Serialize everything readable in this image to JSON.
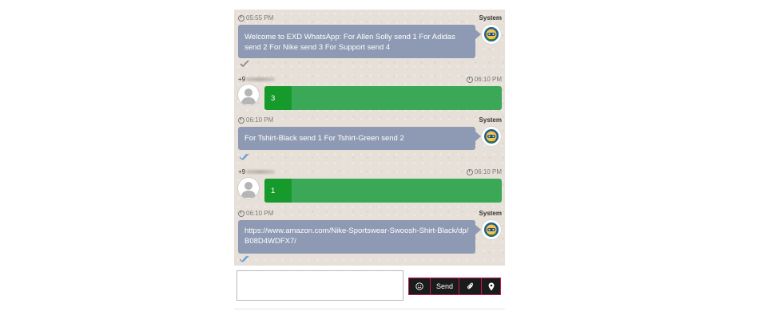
{
  "messages": [
    {
      "type": "system",
      "time": "05:55 PM",
      "sender": "System",
      "text": "Welcome to EXD WhatsApp: For Allen Solly send 1 For Adidas send 2 For Nike send 3  For Support send 4",
      "status": "single-check-icon"
    },
    {
      "type": "user",
      "time": "06:10 PM",
      "sender": "+9",
      "text": "3"
    },
    {
      "type": "system",
      "time": "06:10 PM",
      "sender": "System",
      "text": "For Tshirt-Black send 1 For Tshirt-Green send 2",
      "status": "double-check-icon"
    },
    {
      "type": "user",
      "time": "06:10 PM",
      "sender": "+9",
      "text": "1"
    },
    {
      "type": "system",
      "time": "06:10 PM",
      "sender": "System",
      "text": "https://www.amazon.com/Nike-Sportswear-Swoosh-Shirt-Black/dp/B08D4WDFX7/",
      "status": "double-check-icon"
    }
  ],
  "composer": {
    "placeholder": "",
    "emoji_icon": "smiley-icon",
    "send_label": "Send",
    "attach_icon": "paperclip-icon",
    "location_icon": "location-pin-icon"
  },
  "colors": {
    "system_bubble": "#8e9ab3",
    "user_bubble": "#3aa857",
    "user_bubble_dark": "#179a2c",
    "chat_bg": "#e6e0d8",
    "button_bg": "#1b1b1b",
    "button_border": "#c2185b",
    "read_tick": "#5b9bd5"
  }
}
